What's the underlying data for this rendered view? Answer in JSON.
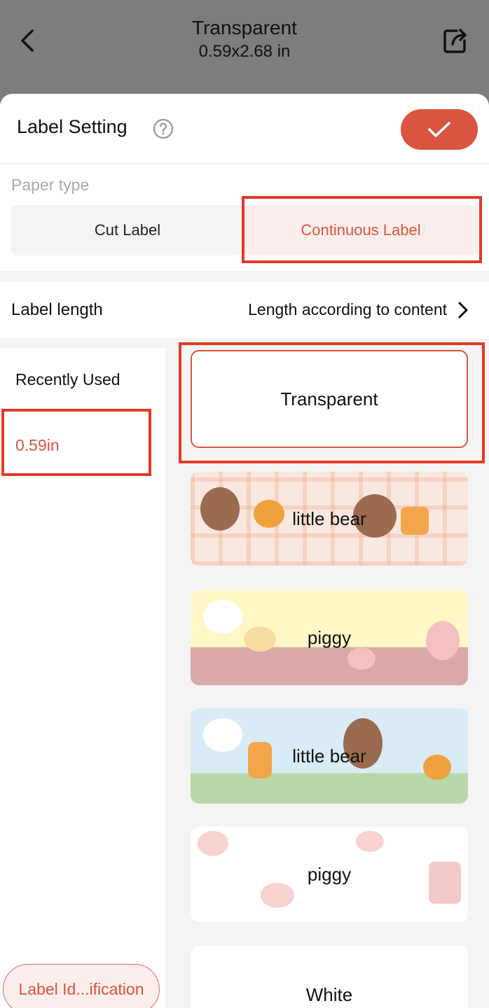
{
  "header": {
    "title": "Transparent",
    "subtitle": "0.59x2.68 in"
  },
  "sheet": {
    "title": "Label Setting",
    "paper_type_label": "Paper type",
    "paper_options": [
      "Cut Label",
      "Continuous Label"
    ],
    "selected_paper": "Continuous Label",
    "label_length_label": "Label length",
    "label_length_value": "Length according to content"
  },
  "sidebar": {
    "recent_label": "Recently Used",
    "sizes": [
      "0.59in"
    ],
    "identify_button": "Label Id...ification"
  },
  "materials": [
    {
      "name": "Transparent"
    },
    {
      "name": "little bear"
    },
    {
      "name": "piggy"
    },
    {
      "name": "little bear"
    },
    {
      "name": "piggy"
    },
    {
      "name": "White"
    }
  ],
  "colors": {
    "accent": "#da5540",
    "highlight_box": "#e43a25",
    "overlay": "#7d7d7d"
  }
}
